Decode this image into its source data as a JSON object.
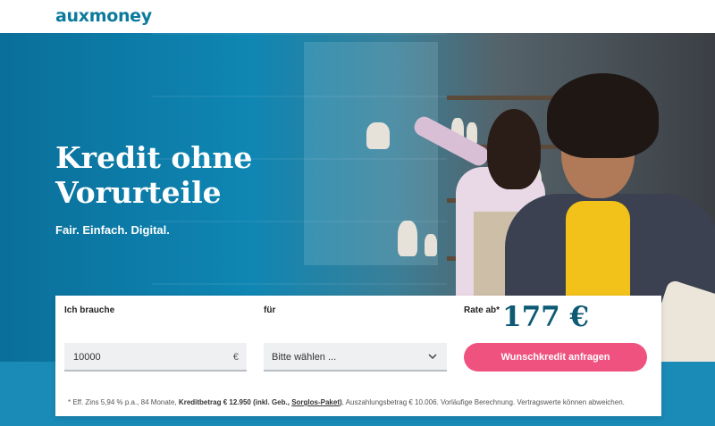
{
  "header": {
    "logo_text": "auxmoney"
  },
  "hero": {
    "headline_line1": "Kredit ohne",
    "headline_line2": "Vorurteile",
    "tagline": "Fair. Einfach. Digital.",
    "carousel": {
      "slides": 4,
      "active_index": 3
    }
  },
  "form": {
    "amount_label": "Ich brauche",
    "amount_value": "10000",
    "currency_symbol": "€",
    "purpose_label": "für",
    "purpose_placeholder": "Bitte wählen ...",
    "rate_label": "Rate ab*",
    "rate_value": "177 €",
    "cta_label": "Wunschkredit anfragen"
  },
  "footnote": {
    "part1": "* Eff. Zins 5,94 % p.a., 84 Monate, ",
    "bold": "Kreditbetrag € 12.950 (inkl. Geb., ",
    "link": "Sorglos-Paket",
    "bold_end": ")",
    "part2": ", Auszahlungsbetrag € 10.006. Vorläufige Berechnung. Vertragswerte können abweichen."
  },
  "colors": {
    "brand": "#0c7a9c",
    "cta": "#f0527f",
    "rate": "#0c5a73"
  }
}
